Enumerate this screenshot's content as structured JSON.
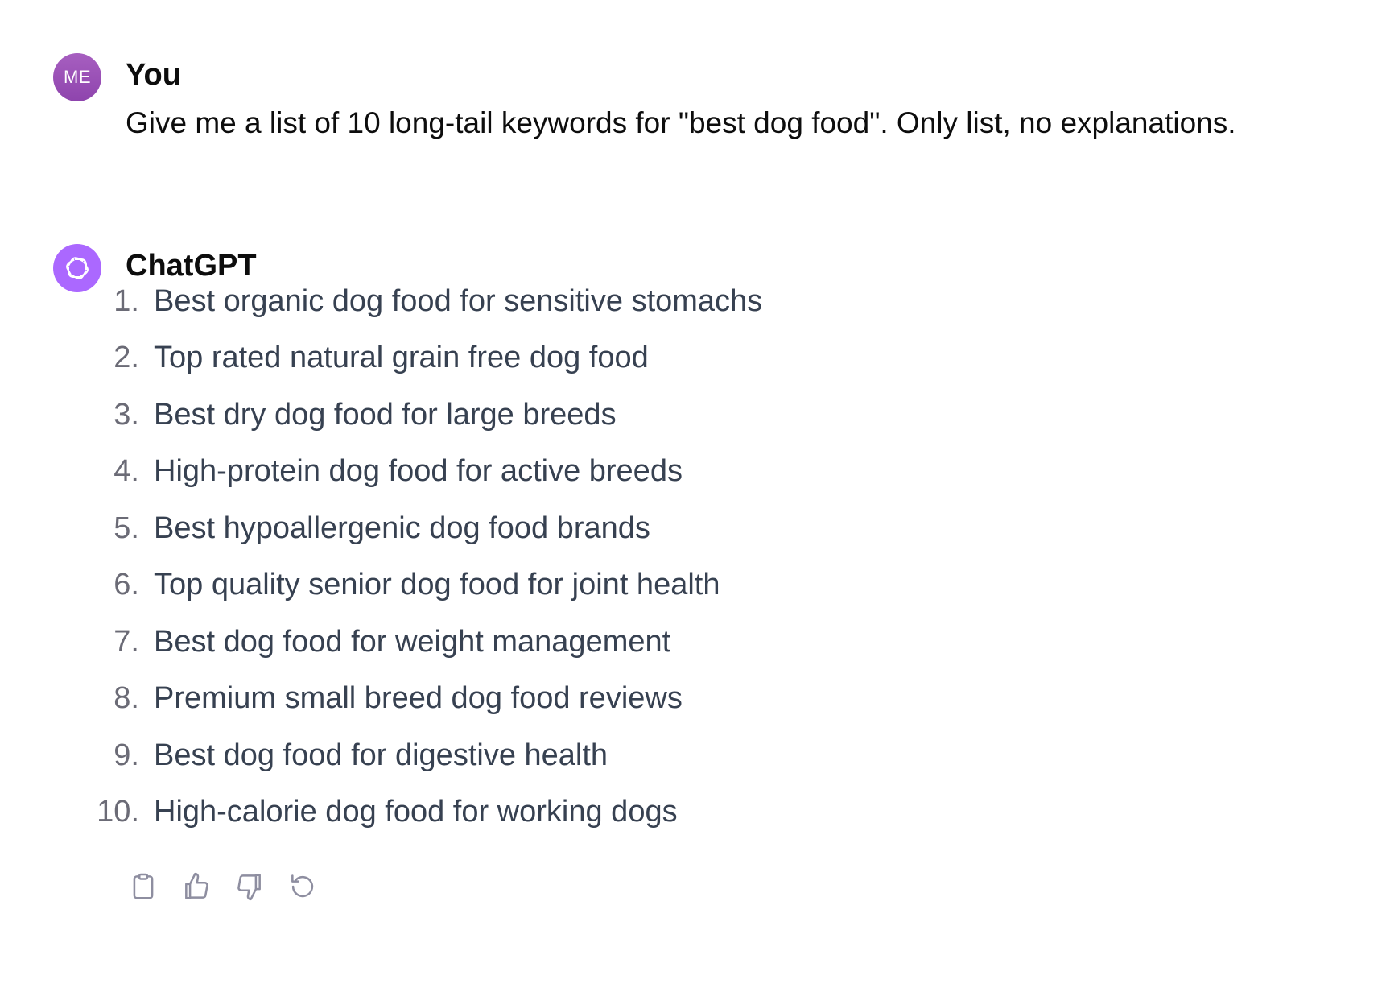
{
  "conversation": {
    "user_message": {
      "avatar_initials": "ME",
      "author": "You",
      "text": "Give me a list of 10 long-tail keywords for \"best dog food\". Only list, no explanations."
    },
    "assistant_message": {
      "avatar_icon": "openai-logo-icon",
      "author": "ChatGPT",
      "items": [
        {
          "num": "1.",
          "text": "Best organic dog food for sensitive stomachs"
        },
        {
          "num": "2.",
          "text": "Top rated natural grain free dog food"
        },
        {
          "num": "3.",
          "text": "Best dry dog food for large breeds"
        },
        {
          "num": "4.",
          "text": "High-protein dog food for active breeds"
        },
        {
          "num": "5.",
          "text": "Best hypoallergenic dog food brands"
        },
        {
          "num": "6.",
          "text": "Top quality senior dog food for joint health"
        },
        {
          "num": "7.",
          "text": "Best dog food for weight management"
        },
        {
          "num": "8.",
          "text": "Premium small breed dog food reviews"
        },
        {
          "num": "9.",
          "text": "Best dog food for digestive health"
        },
        {
          "num": "10.",
          "text": "High-calorie dog food for working dogs"
        }
      ],
      "actions": [
        {
          "icon": "clipboard-icon"
        },
        {
          "icon": "thumbs-up-icon"
        },
        {
          "icon": "thumbs-down-icon"
        },
        {
          "icon": "regenerate-icon"
        }
      ]
    }
  },
  "colors": {
    "user_avatar": "#9b59b6",
    "assistant_avatar": "#ab68ff",
    "list_text": "#374151",
    "list_number": "#6b6b76",
    "action_icon": "#8e8ea0"
  }
}
